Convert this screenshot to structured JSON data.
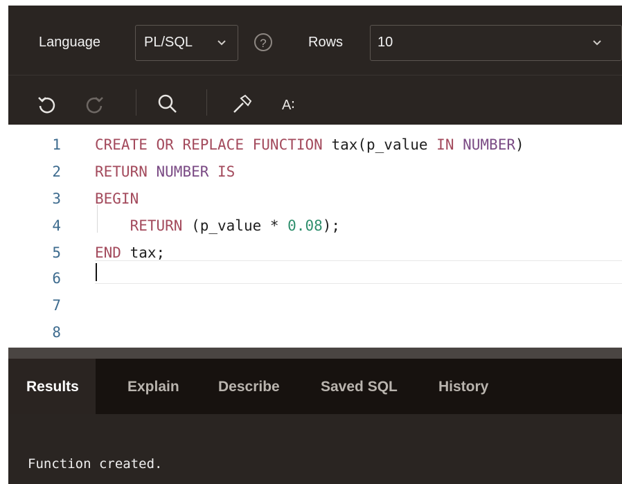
{
  "toolbar": {
    "language_label": "Language",
    "language_value": "PL/SQL",
    "help_symbol": "?",
    "rows_label": "Rows",
    "rows_value": "10"
  },
  "editor_tools": {
    "format_label": "A∶"
  },
  "editor": {
    "line_numbers": [
      "1",
      "2",
      "3",
      "4",
      "5",
      "6",
      "7",
      "8"
    ]
  },
  "tabs": [
    "Results",
    "Explain",
    "Describe",
    "Saved SQL",
    "History"
  ],
  "result_message": "Function created.",
  "colors": {
    "keyword": "#a34a5c",
    "type": "#7a4a84",
    "number": "#2f8f6d",
    "line_number": "#3d6b8e"
  }
}
